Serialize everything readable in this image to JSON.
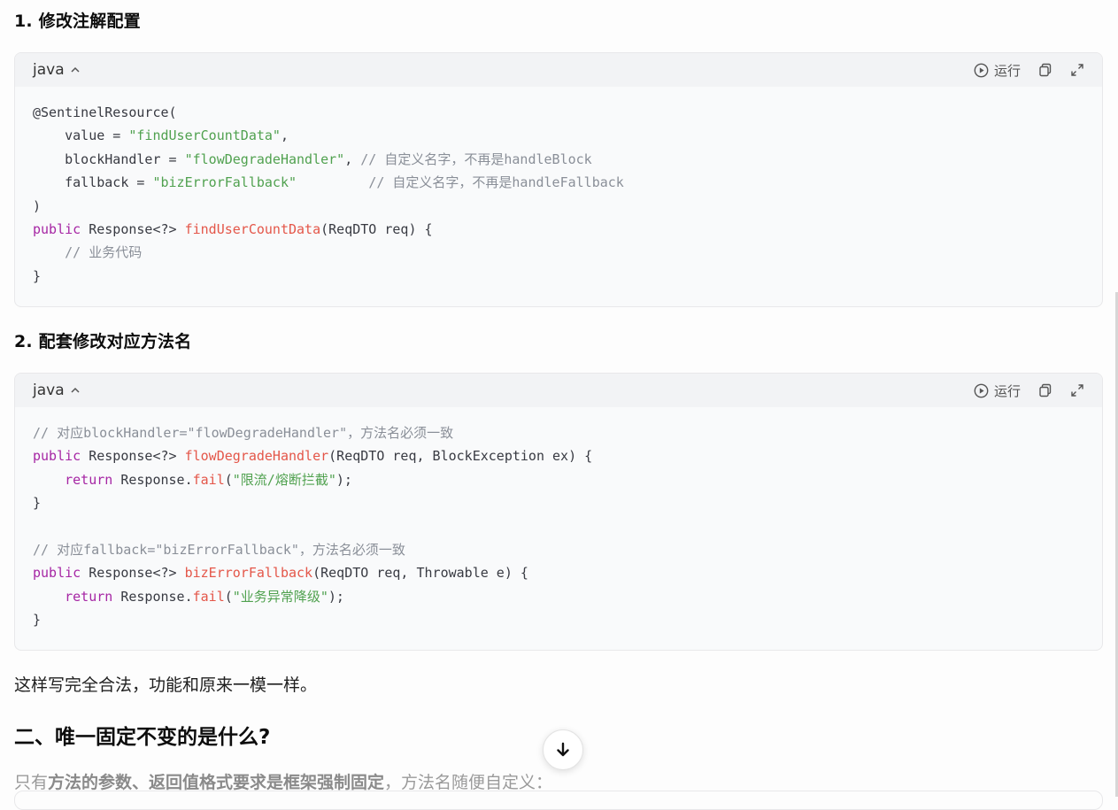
{
  "section1": {
    "title": "1. 修改注解配置"
  },
  "section2": {
    "title": "2. 配套修改对应方法名"
  },
  "code_blocks": [
    {
      "lang": "java",
      "run_label": "运行"
    },
    {
      "lang": "java",
      "run_label": "运行"
    }
  ],
  "code1_lines": {
    "l1": "@SentinelResource(",
    "l2_a": "    value = ",
    "l2_s": "\"findUserCountData\"",
    "l2_b": ",",
    "l3_a": "    blockHandler = ",
    "l3_s": "\"flowDegradeHandler\"",
    "l3_b": ", ",
    "l3_c": "// 自定义名字，不再是handleBlock",
    "l4_a": "    fallback = ",
    "l4_s": "\"bizErrorFallback\"",
    "l4_b": "         ",
    "l4_c": "// 自定义名字，不再是handleFallback",
    "l5": ")",
    "l6_k": "public",
    "l6_a": " Response<?> ",
    "l6_f": "findUserCountData",
    "l6_b": "(ReqDTO req) {",
    "l7": "    // 业务代码",
    "l8": "}"
  },
  "code2_lines": {
    "l1": "// 对应blockHandler=\"flowDegradeHandler\"，方法名必须一致",
    "l2_k": "public",
    "l2_a": " Response<?> ",
    "l2_f": "flowDegradeHandler",
    "l2_b": "(ReqDTO req, BlockException ex) {",
    "l3_k": "    return",
    "l3_a": " Response.",
    "l3_f": "fail",
    "l3_b": "(",
    "l3_s": "\"限流/熔断拦截\"",
    "l3_c": ");",
    "l4": "}",
    "l6": "// 对应fallback=\"bizErrorFallback\"，方法名必须一致",
    "l7_k": "public",
    "l7_a": " Response<?> ",
    "l7_f": "bizErrorFallback",
    "l7_b": "(ReqDTO req, Throwable e) {",
    "l8_k": "    return",
    "l8_a": " Response.",
    "l8_f": "fail",
    "l8_b": "(",
    "l8_s": "\"业务异常降级\"",
    "l8_c": ");",
    "l9": "}"
  },
  "paragraph1": "这样写完全合法，功能和原来一模一样。",
  "heading2": "二、唯一固定不变的是什么?",
  "paragraph2": {
    "pre": "只有",
    "bold": "方法的参数、返回值格式要求是框架强制固定",
    "post": "，方法名随便自定义："
  }
}
